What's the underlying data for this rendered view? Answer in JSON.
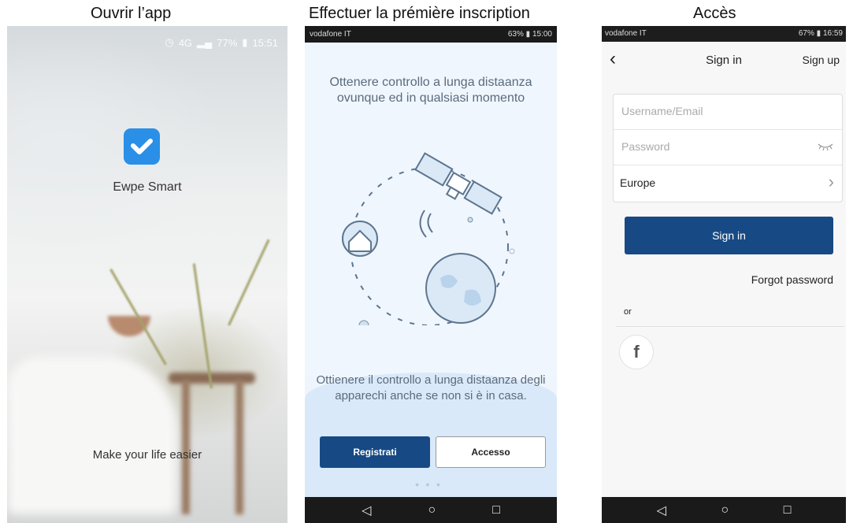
{
  "captions": {
    "open_app": "Ouvrir l’app",
    "first_signup": "Effectuer la prémière inscription",
    "access": "Accès"
  },
  "splash": {
    "status": {
      "network": "4G",
      "battery": "77%",
      "time": "15:51"
    },
    "app_name": "Ewpe Smart",
    "slogan": "Make your life easier",
    "logo_icon": "ewpe-check-logo",
    "logo_color": "#2a8fe7"
  },
  "onboarding": {
    "status": {
      "carrier": "vodafone IT",
      "battery": "63%",
      "time": "15:00"
    },
    "headline": "Ottenere controllo a lunga distaanza ovunque ed in qualsiasi momento",
    "description": "Ottienere il controllo a lunga distaanza degli apparechi anche se non si è in casa.",
    "register_label": "Registrati",
    "access_label": "Accesso",
    "accent_color": "#174a84"
  },
  "signin": {
    "status": {
      "carrier": "vodafone IT",
      "battery": "67%",
      "time": "16:59"
    },
    "title": "Sign in",
    "signup_label": "Sign up",
    "username_placeholder": "Username/Email",
    "password_placeholder": "Password",
    "region": "Europe",
    "signin_label": "Sign in",
    "forgot_label": "Forgot password",
    "or_label": "or",
    "facebook_icon": "facebook-icon"
  }
}
